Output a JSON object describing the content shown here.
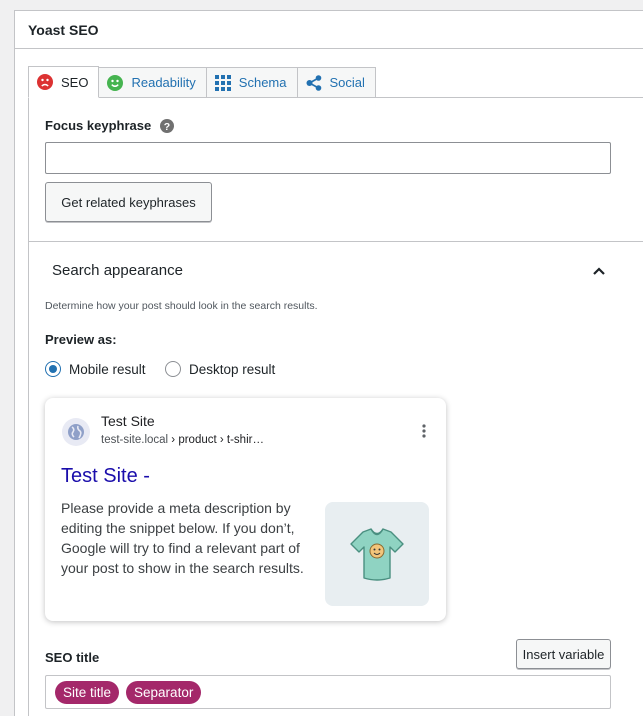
{
  "panel": {
    "title": "Yoast SEO"
  },
  "tabs": [
    {
      "label": "SEO",
      "icon": "sad-face-icon",
      "active": true
    },
    {
      "label": "Readability",
      "icon": "smile-face-icon",
      "active": false
    },
    {
      "label": "Schema",
      "icon": "grid-icon",
      "active": false
    },
    {
      "label": "Social",
      "icon": "share-icon",
      "active": false
    }
  ],
  "focus": {
    "label": "Focus keyphrase",
    "value": "",
    "button_label": "Get related keyphrases"
  },
  "search_appearance": {
    "title": "Search appearance",
    "description": "Determine how your post should look in the search results.",
    "preview_label": "Preview as:",
    "options": [
      "Mobile result",
      "Desktop result"
    ],
    "selected": "Mobile result"
  },
  "preview": {
    "site_name": "Test Site",
    "url_domain": "test-site.local",
    "url_path": " › product › t-shir…",
    "title": "Test Site -",
    "snippet": "Please provide a meta description by editing the snippet below. If you don’t, Google will try to find a relevant part of your post to show in the search results."
  },
  "seo_title": {
    "label": "SEO title",
    "insert_button": "Insert variable",
    "pills": [
      "Site title",
      "Separator"
    ]
  },
  "colors": {
    "link_blue": "#2271b1",
    "result_title": "#1a0dab",
    "pill": "#a4286a",
    "sad_face": "#dc3232",
    "smile_face": "#46b450"
  }
}
